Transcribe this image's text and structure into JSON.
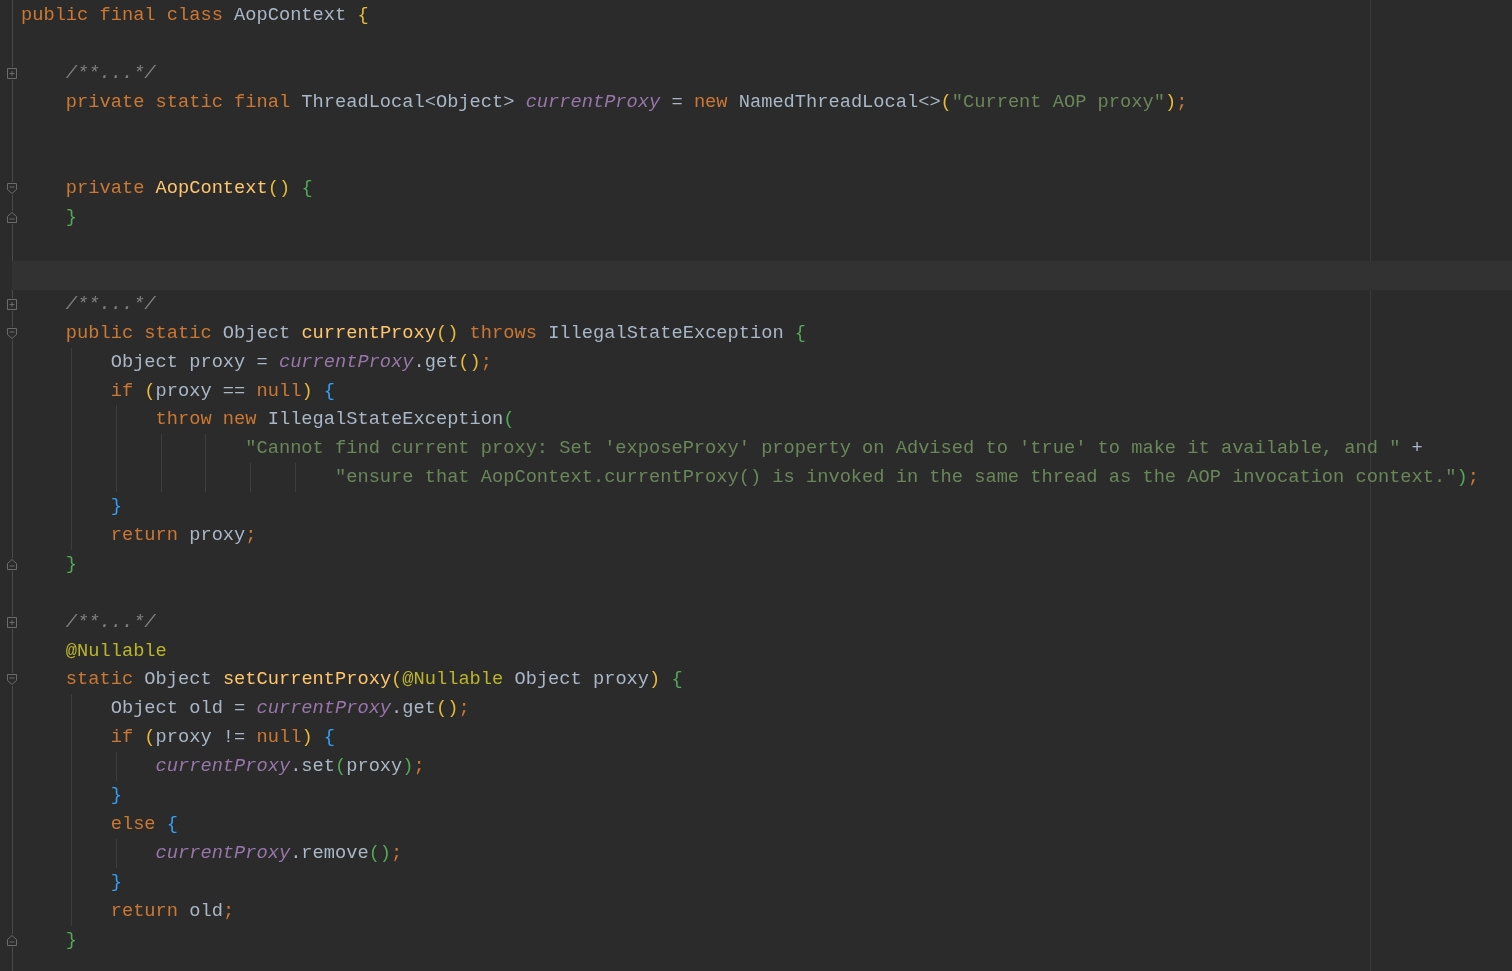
{
  "lines": [
    {
      "kind": "code",
      "tokens": [
        {
          "kind": "keyword",
          "text": "public final class "
        },
        {
          "kind": "text",
          "text": "AopContext "
        },
        {
          "kind": "paren-1",
          "text": "{"
        }
      ]
    },
    {
      "kind": "blank"
    },
    {
      "kind": "code",
      "fold_icon": {
        "kind": "plus"
      },
      "tokens": [
        {
          "kind": "comment",
          "text": "    /**...*/"
        }
      ]
    },
    {
      "kind": "code",
      "tokens": [
        {
          "kind": "keyword",
          "text": "    private static final "
        },
        {
          "kind": "text",
          "text": "ThreadLocal<Object> "
        },
        {
          "kind": "field",
          "text": "currentProxy"
        },
        {
          "kind": "text",
          "text": " = "
        },
        {
          "kind": "keyword",
          "text": "new "
        },
        {
          "kind": "text",
          "text": "NamedThreadLocal<>"
        },
        {
          "kind": "paren-1",
          "text": "("
        },
        {
          "kind": "string",
          "text": "\"Current AOP proxy\""
        },
        {
          "kind": "paren-1",
          "text": ")"
        },
        {
          "kind": "keyword",
          "text": ";"
        }
      ]
    },
    {
      "kind": "blank"
    },
    {
      "kind": "blank"
    },
    {
      "kind": "code",
      "fold_icon": {
        "kind": "open"
      },
      "tokens": [
        {
          "kind": "keyword",
          "text": "    private "
        },
        {
          "kind": "method",
          "text": "AopContext"
        },
        {
          "kind": "paren-1",
          "text": "() "
        },
        {
          "kind": "paren-2",
          "text": "{"
        }
      ]
    },
    {
      "kind": "code",
      "fold_icon": {
        "kind": "close"
      },
      "tokens": [
        {
          "kind": "paren-2",
          "text": "    }"
        }
      ]
    },
    {
      "kind": "blank"
    },
    {
      "kind": "caret-line"
    },
    {
      "kind": "code",
      "fold_icon": {
        "kind": "plus"
      },
      "tokens": [
        {
          "kind": "comment",
          "text": "    /**...*/"
        }
      ]
    },
    {
      "kind": "code",
      "fold_icon": {
        "kind": "open"
      },
      "tokens": [
        {
          "kind": "keyword",
          "text": "    public static "
        },
        {
          "kind": "text",
          "text": "Object "
        },
        {
          "kind": "method",
          "text": "currentProxy"
        },
        {
          "kind": "paren-1",
          "text": "() "
        },
        {
          "kind": "keyword",
          "text": "throws "
        },
        {
          "kind": "text",
          "text": "IllegalStateException "
        },
        {
          "kind": "paren-2",
          "text": "{"
        }
      ]
    },
    {
      "kind": "code",
      "tokens": [
        {
          "kind": "text",
          "text": "        Object proxy = "
        },
        {
          "kind": "field",
          "text": "currentProxy"
        },
        {
          "kind": "text",
          "text": ".get"
        },
        {
          "kind": "paren-1",
          "text": "()"
        },
        {
          "kind": "keyword",
          "text": ";"
        }
      ]
    },
    {
      "kind": "code",
      "tokens": [
        {
          "kind": "keyword",
          "text": "        if "
        },
        {
          "kind": "paren-1",
          "text": "("
        },
        {
          "kind": "text",
          "text": "proxy == "
        },
        {
          "kind": "keyword",
          "text": "null"
        },
        {
          "kind": "paren-1",
          "text": ") "
        },
        {
          "kind": "paren-3",
          "text": "{"
        }
      ]
    },
    {
      "kind": "code",
      "tokens": [
        {
          "kind": "keyword",
          "text": "            throw new "
        },
        {
          "kind": "text",
          "text": "IllegalStateException"
        },
        {
          "kind": "paren-2",
          "text": "("
        }
      ]
    },
    {
      "kind": "code",
      "tokens": [
        {
          "kind": "string",
          "text": "                    \"Cannot find current proxy: Set 'exposeProxy' property on Advised to 'true' to make it available, and \""
        },
        {
          "kind": "text",
          "text": " +"
        }
      ]
    },
    {
      "kind": "code",
      "tokens": [
        {
          "kind": "string",
          "text": "                            \"ensure that AopContext.currentProxy() is invoked in the same thread as the AOP invocation context.\""
        },
        {
          "kind": "paren-2",
          "text": ")"
        },
        {
          "kind": "keyword",
          "text": ";"
        }
      ]
    },
    {
      "kind": "code",
      "tokens": [
        {
          "kind": "paren-3",
          "text": "        }"
        }
      ]
    },
    {
      "kind": "code",
      "tokens": [
        {
          "kind": "keyword",
          "text": "        return "
        },
        {
          "kind": "text",
          "text": "proxy"
        },
        {
          "kind": "keyword",
          "text": ";"
        }
      ]
    },
    {
      "kind": "code",
      "fold_icon": {
        "kind": "close"
      },
      "tokens": [
        {
          "kind": "paren-2",
          "text": "    }"
        }
      ]
    },
    {
      "kind": "blank"
    },
    {
      "kind": "code",
      "fold_icon": {
        "kind": "plus"
      },
      "tokens": [
        {
          "kind": "comment",
          "text": "    /**...*/"
        }
      ]
    },
    {
      "kind": "code",
      "tokens": [
        {
          "kind": "annotation",
          "text": "    @Nullable"
        }
      ]
    },
    {
      "kind": "code",
      "fold_icon": {
        "kind": "open"
      },
      "tokens": [
        {
          "kind": "keyword",
          "text": "    static "
        },
        {
          "kind": "text",
          "text": "Object "
        },
        {
          "kind": "method",
          "text": "setCurrentProxy"
        },
        {
          "kind": "paren-1",
          "text": "("
        },
        {
          "kind": "annotation",
          "text": "@Nullable "
        },
        {
          "kind": "text",
          "text": "Object proxy"
        },
        {
          "kind": "paren-1",
          "text": ") "
        },
        {
          "kind": "paren-2",
          "text": "{"
        }
      ]
    },
    {
      "kind": "code",
      "tokens": [
        {
          "kind": "text",
          "text": "        Object old = "
        },
        {
          "kind": "field",
          "text": "currentProxy"
        },
        {
          "kind": "text",
          "text": ".get"
        },
        {
          "kind": "paren-1",
          "text": "()"
        },
        {
          "kind": "keyword",
          "text": ";"
        }
      ]
    },
    {
      "kind": "code",
      "tokens": [
        {
          "kind": "keyword",
          "text": "        if "
        },
        {
          "kind": "paren-1",
          "text": "("
        },
        {
          "kind": "text",
          "text": "proxy != "
        },
        {
          "kind": "keyword",
          "text": "null"
        },
        {
          "kind": "paren-1",
          "text": ") "
        },
        {
          "kind": "paren-3",
          "text": "{"
        }
      ]
    },
    {
      "kind": "code",
      "tokens": [
        {
          "kind": "field",
          "text": "            currentProxy"
        },
        {
          "kind": "text",
          "text": ".set"
        },
        {
          "kind": "paren-2",
          "text": "("
        },
        {
          "kind": "text",
          "text": "proxy"
        },
        {
          "kind": "paren-2",
          "text": ")"
        },
        {
          "kind": "keyword",
          "text": ";"
        }
      ]
    },
    {
      "kind": "code",
      "tokens": [
        {
          "kind": "paren-3",
          "text": "        }"
        }
      ]
    },
    {
      "kind": "code",
      "tokens": [
        {
          "kind": "keyword",
          "text": "        else "
        },
        {
          "kind": "paren-3",
          "text": "{"
        }
      ]
    },
    {
      "kind": "code",
      "tokens": [
        {
          "kind": "field",
          "text": "            currentProxy"
        },
        {
          "kind": "text",
          "text": ".remove"
        },
        {
          "kind": "paren-2",
          "text": "()"
        },
        {
          "kind": "keyword",
          "text": ";"
        }
      ]
    },
    {
      "kind": "code",
      "tokens": [
        {
          "kind": "paren-3",
          "text": "        }"
        }
      ]
    },
    {
      "kind": "code",
      "tokens": [
        {
          "kind": "keyword",
          "text": "        return "
        },
        {
          "kind": "text",
          "text": "old"
        },
        {
          "kind": "keyword",
          "text": ";"
        }
      ]
    },
    {
      "kind": "code",
      "fold_icon": {
        "kind": "close"
      },
      "tokens": [
        {
          "kind": "paren-2",
          "text": "    }"
        }
      ]
    }
  ]
}
